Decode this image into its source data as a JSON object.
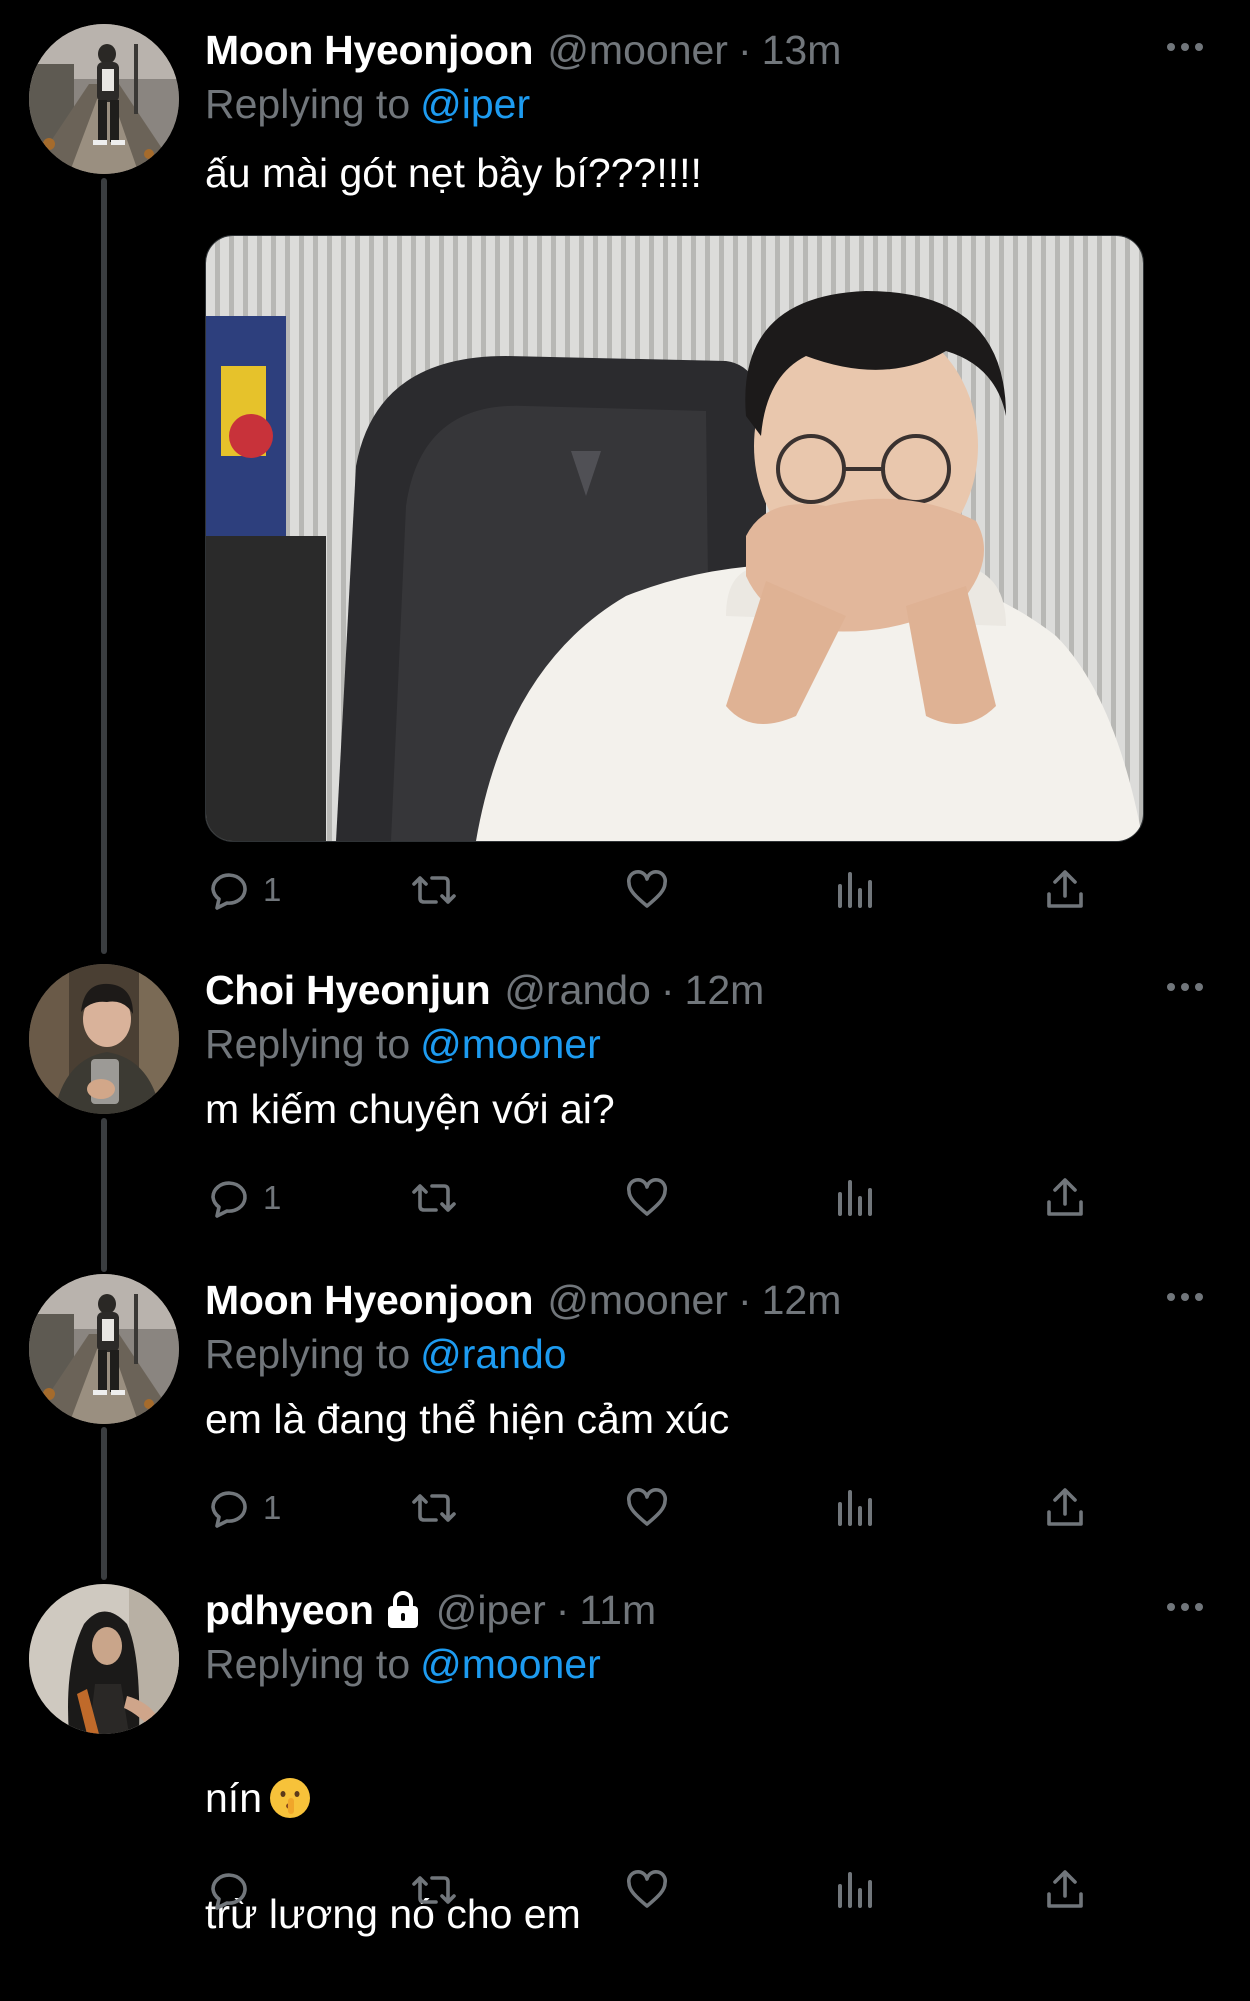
{
  "thread": [
    {
      "name": "Moon Hyeonjoon",
      "handle": "@mooner",
      "time": "13m",
      "replying_label": "Replying to",
      "replying_to": "@iper",
      "text": "ấu mài gót nẹt bầy bí???!!!!",
      "has_media": true,
      "reply_count": "1",
      "icons": [
        "reply-icon",
        "retweet-icon",
        "like-icon",
        "views-icon",
        "share-icon",
        "more-icon"
      ]
    },
    {
      "name": "Choi Hyeonjun",
      "handle": "@rando",
      "time": "12m",
      "replying_label": "Replying to",
      "replying_to": "@mooner",
      "text": "m kiếm chuyện với ai?",
      "reply_count": "1"
    },
    {
      "name": "Moon Hyeonjoon",
      "handle": "@mooner",
      "time": "12m",
      "replying_label": "Replying to",
      "replying_to": "@rando",
      "text": "em là đang thể hiện cảm xúc",
      "reply_count": "1"
    },
    {
      "name": "pdhyeon",
      "handle": "@iper",
      "time": "11m",
      "replying_label": "Replying to",
      "replying_to": "@mooner",
      "text_line1": "nín",
      "text_line2": "trừ lương nó cho em",
      "locked": true,
      "emoji": "shushing-face-emoji",
      "reply_count": ""
    }
  ],
  "separator": "·",
  "colors": {
    "background": "#000000",
    "name": "#ffffff",
    "muted": "#71767b",
    "link": "#1d9bf0",
    "thread_line": "#3a3d40"
  }
}
